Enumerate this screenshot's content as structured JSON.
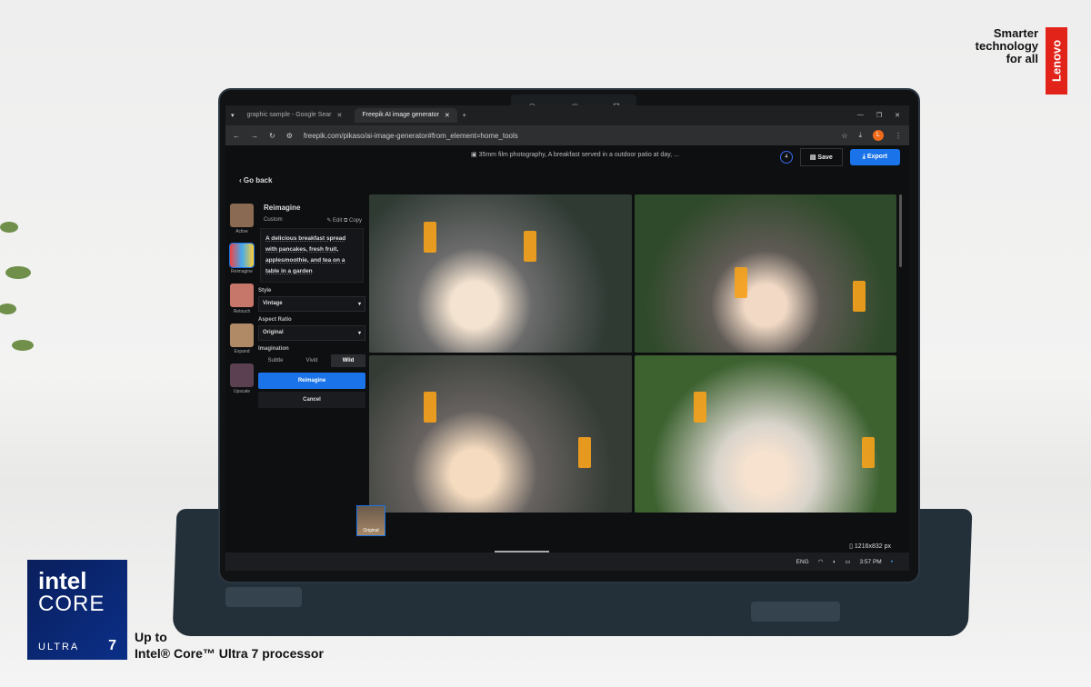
{
  "overlay": {
    "brand_tagline": [
      "Smarter",
      "technology",
      "for all"
    ],
    "brand_logo": "Lenovo",
    "intel_badge": {
      "word": "intel",
      "line2": "CORE",
      "line3": "ULTRA",
      "number": "7"
    },
    "processor_caption": [
      "Up to",
      "Intel® Core™ Ultra 7 processor"
    ]
  },
  "browser": {
    "tabs": [
      {
        "label": "graphic sample - Google Sear"
      },
      {
        "label": "Freepik AI image generator",
        "active": true
      }
    ],
    "new_tab": "+",
    "url": "freepik.com/pikaso/ai-image-generator#from_element=home_tools",
    "profile_initial": "L"
  },
  "app": {
    "prompt_preview": "35mm film photography, A breakfast served in a outdoor patio at day, ...",
    "count_badge": "4",
    "save_label": "Save",
    "export_label": "Export",
    "go_back": "Go back",
    "tools": [
      {
        "label": "Active"
      },
      {
        "label": "Reimagine"
      },
      {
        "label": "Retouch"
      },
      {
        "label": "Expand"
      },
      {
        "label": "Upscale"
      }
    ],
    "panel": {
      "title": "Reimagine",
      "custom_label": "Custom",
      "edit": "Edit",
      "copy": "Copy",
      "prompt": "A delicious breakfast spread with pancakes, fresh fruit, applesmoothie, and tea on a table in a garden",
      "style_label": "Style",
      "style_value": "Vintage",
      "aspect_label": "Aspect Ratio",
      "aspect_value": "Original",
      "imagination_label": "Imagination",
      "imagination_options": [
        "Subtle",
        "Vivid",
        "Wild"
      ],
      "imagination_selected": "Wild",
      "primary": "Reimagine",
      "cancel": "Cancel"
    },
    "thumb_label": "Original",
    "dimensions": "1216x832 px",
    "accent": "#1a73e8"
  },
  "taskbar": {
    "lang": "ENG",
    "time": "3:57 PM"
  }
}
